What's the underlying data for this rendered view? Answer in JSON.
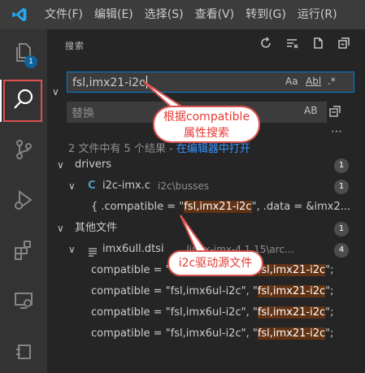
{
  "menubar": {
    "items": [
      "文件(F)",
      "编辑(E)",
      "选择(S)",
      "查看(V)",
      "转到(G)",
      "运行(R)"
    ]
  },
  "activity": {
    "explorer_badge": "1"
  },
  "search_panel": {
    "title": "搜索",
    "query": "fsl,imx21-i2c",
    "option_case": "Aa",
    "option_word": "Abl",
    "option_regex": ".*",
    "replace_placeholder": "替换",
    "replace_option": "AB",
    "summary_prefix": "2 文件中有 5 个结果 - ",
    "summary_link": "在编辑器中打开"
  },
  "results": {
    "groups": [
      {
        "folder": "drivers",
        "count": "1",
        "files": [
          {
            "name": "i2c-imx.c",
            "path": "i2c\\busses",
            "count": "1",
            "lines": [
              {
                "pre": "{ .compatible = \"",
                "match": "fsl,imx21-i2c",
                "post": "\", .data = &imx2..."
              }
            ]
          }
        ]
      },
      {
        "folder": "其他文件",
        "count": "1",
        "files": [
          {
            "name": "imx6ull.dtsi",
            "path": "...linux-imx-4.1.15\\arc...",
            "count": "4",
            "lines": [
              {
                "pre": "compatible = \"fsl,imx6ul-i2c\", \"",
                "match": "fsl,imx21-i2c",
                "post": "\";"
              },
              {
                "pre": "compatible = \"fsl,imx6ul-i2c\", \"",
                "match": "fsl,imx21-i2c",
                "post": "\";"
              },
              {
                "pre": "compatible = \"fsl,imx6ul-i2c\", \"",
                "match": "fsl,imx21-i2c",
                "post": "\";"
              },
              {
                "pre": "compatible = \"fsl,imx6ul-i2c\", \"",
                "match": "fsl,imx21-i2c",
                "post": "\";"
              }
            ]
          }
        ]
      }
    ]
  },
  "annotations": {
    "callout_1_line1": "根据compatible",
    "callout_1_line2": "属性搜索",
    "callout_2": "i2c驱动源文件",
    "highlight_color": "#e05050"
  },
  "colors": {
    "accent": "#007fd4",
    "match_bg": "#613214",
    "link": "#3794ff"
  },
  "icons": [
    "vscode-logo-icon",
    "files-icon",
    "search-icon",
    "source-control-icon",
    "run-debug-icon",
    "extensions-icon",
    "remote-explorer-icon",
    "refresh-icon",
    "clear-results-icon",
    "new-search-editor-icon",
    "collapse-all-icon",
    "replace-all-icon",
    "c-file-icon",
    "list-file-icon"
  ]
}
